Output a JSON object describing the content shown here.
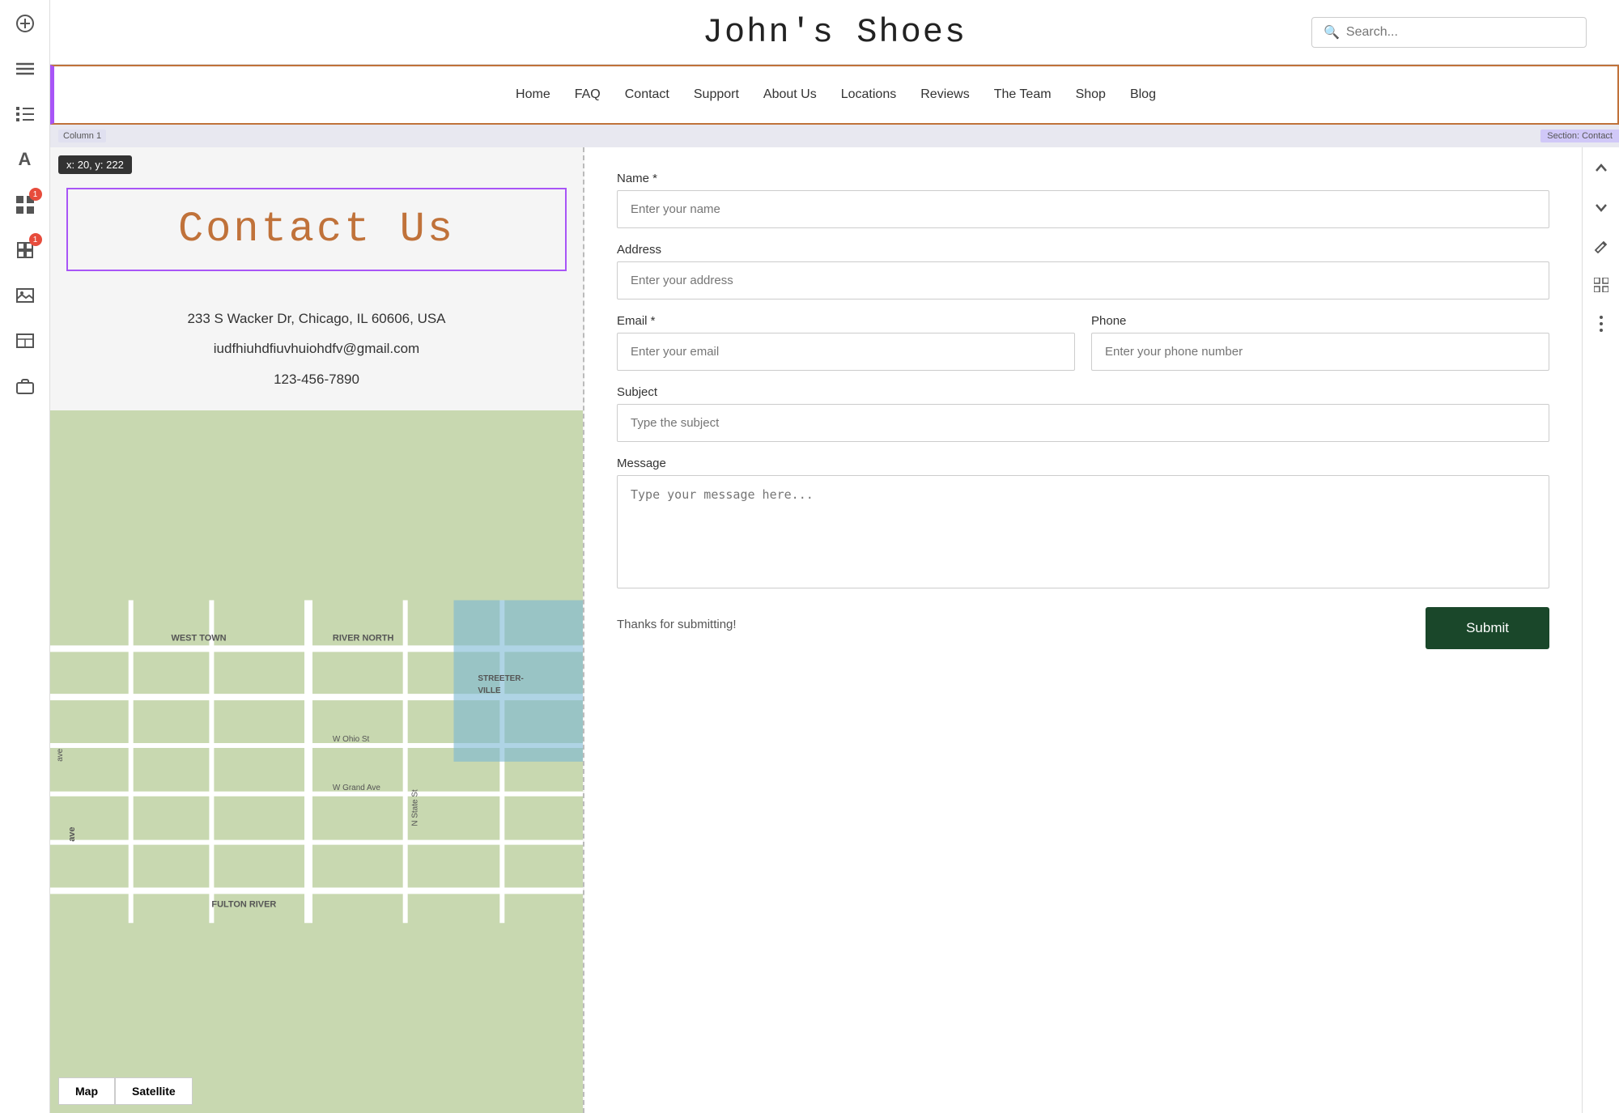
{
  "header": {
    "title": "John's Shoes",
    "search_placeholder": "Search..."
  },
  "nav": {
    "items": [
      {
        "label": "Home"
      },
      {
        "label": "FAQ"
      },
      {
        "label": "Contact"
      },
      {
        "label": "Support"
      },
      {
        "label": "About Us"
      },
      {
        "label": "Locations"
      },
      {
        "label": "Reviews"
      },
      {
        "label": "The Team"
      },
      {
        "label": "Shop"
      },
      {
        "label": "Blog"
      }
    ]
  },
  "section": {
    "column_label": "Column 1",
    "section_label": "Section: Contact"
  },
  "tooltip": {
    "text": "x: 20, y: 222"
  },
  "contact": {
    "heading": "Contact Us",
    "address": "233 S Wacker Dr, Chicago, IL 60606, USA",
    "email": "iudfhiuhdfiuvhuiohdfv@gmail.com",
    "phone": "123-456-7890"
  },
  "map": {
    "map_btn": "Map",
    "satellite_btn": "Satellite",
    "labels": [
      "WEST TOWN",
      "RIVER NORTH",
      "STREETERVILLE",
      "FULTON RIVER",
      "W Ohio St",
      "W Grand Ave"
    ]
  },
  "form": {
    "name_label": "Name *",
    "name_placeholder": "Enter your name",
    "address_label": "Address",
    "address_placeholder": "Enter your address",
    "email_label": "Email *",
    "email_placeholder": "Enter your email",
    "phone_label": "Phone",
    "phone_placeholder": "Enter your phone number",
    "subject_label": "Subject",
    "subject_placeholder": "Type the subject",
    "message_label": "Message",
    "message_placeholder": "Type your message here...",
    "submit_label": "Submit",
    "thanks_text": "Thanks for submitting!"
  },
  "sidebar": {
    "icons": [
      {
        "name": "plus-icon",
        "glyph": "+"
      },
      {
        "name": "menu-icon",
        "glyph": "☰"
      },
      {
        "name": "list-icon",
        "glyph": "☰"
      },
      {
        "name": "type-icon",
        "glyph": "A"
      },
      {
        "name": "grid-icon",
        "glyph": "⊞",
        "badge": 1
      },
      {
        "name": "puzzle-icon",
        "glyph": "⚙",
        "badge": 1
      },
      {
        "name": "image-icon",
        "glyph": "🖼"
      },
      {
        "name": "table-icon",
        "glyph": "⊟"
      },
      {
        "name": "briefcase-icon",
        "glyph": "💼"
      }
    ]
  },
  "right_toolbar": {
    "icons": [
      {
        "name": "arrow-up-icon",
        "glyph": "↑"
      },
      {
        "name": "arrow-down-icon",
        "glyph": "↓"
      },
      {
        "name": "edit-icon",
        "glyph": "✏"
      },
      {
        "name": "grid-rt-icon",
        "glyph": "⊞"
      },
      {
        "name": "more-icon",
        "glyph": "•••"
      }
    ]
  }
}
